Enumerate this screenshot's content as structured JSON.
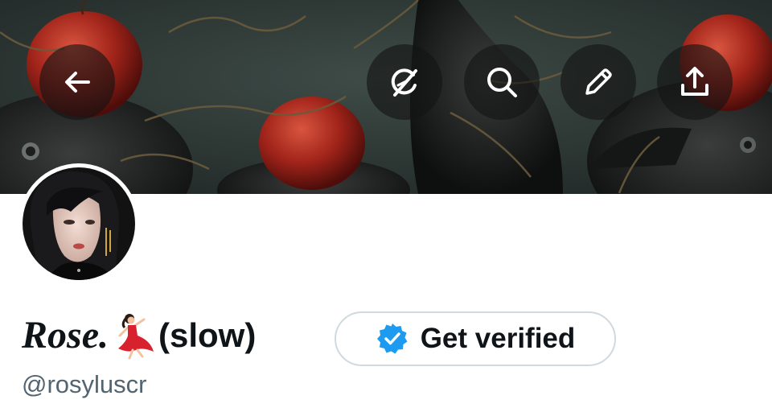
{
  "header": {
    "banner_image": "ravens-and-red-apples-painting",
    "actions": [
      {
        "name": "back",
        "icon": "arrow-left-icon"
      },
      {
        "name": "grok",
        "icon": "grok-icon"
      },
      {
        "name": "search",
        "icon": "search-icon"
      },
      {
        "name": "edit",
        "icon": "pencil-icon"
      },
      {
        "name": "share",
        "icon": "share-icon"
      }
    ]
  },
  "profile": {
    "avatar": "portrait-avatar",
    "display_name": "Rose.",
    "display_emoji": "💃",
    "display_suffix": "(slow)",
    "handle": "@rosyluscr",
    "get_verified_label": "Get verified",
    "verified_badge_color": "#1d9bf0"
  },
  "colors": {
    "text_primary": "#0f1419",
    "text_secondary": "#536471",
    "border": "#cfd9de",
    "accent": "#1d9bf0"
  }
}
